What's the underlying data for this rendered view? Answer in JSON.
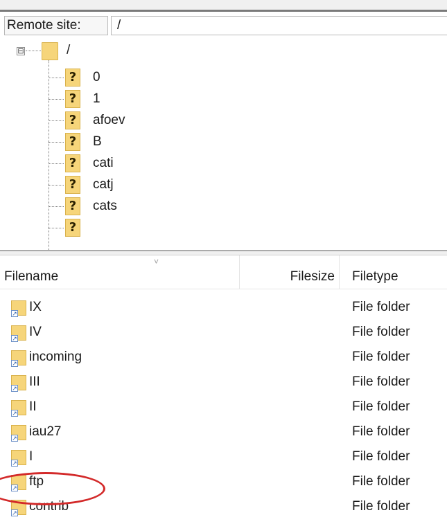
{
  "remote": {
    "label": "Remote site:",
    "path": "/"
  },
  "tree": {
    "expander": "⊟",
    "root_label": "/",
    "items": [
      {
        "label": "0"
      },
      {
        "label": "1"
      },
      {
        "label": "afoev"
      },
      {
        "label": "B"
      },
      {
        "label": "cati"
      },
      {
        "label": "catj"
      },
      {
        "label": "cats"
      }
    ]
  },
  "list": {
    "columns": {
      "filename": "Filename",
      "filesize": "Filesize",
      "filetype": "Filetype"
    },
    "rows": [
      {
        "name": "IX",
        "type": "File folder"
      },
      {
        "name": "IV",
        "type": "File folder"
      },
      {
        "name": "incoming",
        "type": "File folder"
      },
      {
        "name": "III",
        "type": "File folder"
      },
      {
        "name": "II",
        "type": "File folder"
      },
      {
        "name": "iau27",
        "type": "File folder"
      },
      {
        "name": "I",
        "type": "File folder"
      },
      {
        "name": "ftp",
        "type": "File folder"
      },
      {
        "name": "contrib",
        "type": "File folder"
      }
    ]
  },
  "icons": {
    "unknown": "?",
    "shortcut": "↗",
    "sort": "˅"
  },
  "colors": {
    "folder": "#f6d57a",
    "highlight_circle": "#d32a2a"
  }
}
